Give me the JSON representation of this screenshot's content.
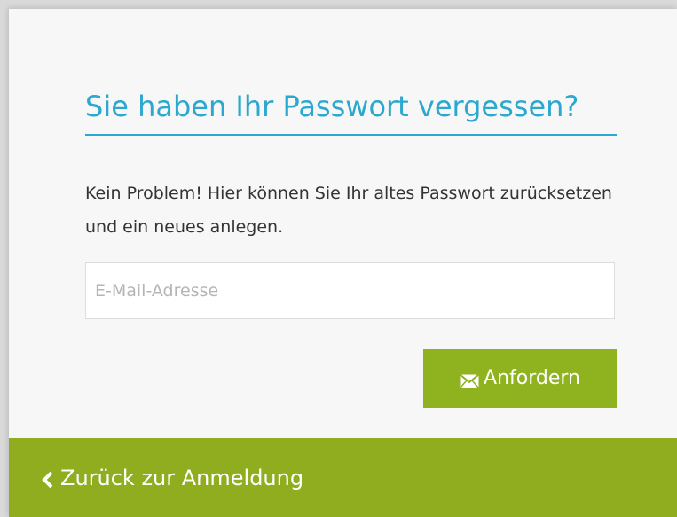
{
  "form": {
    "title": "Sie haben Ihr Passwort vergessen?",
    "description": "Kein Problem! Hier können Sie Ihr altes Passwort zurücksetzen und ein neues anlegen.",
    "email_value": "",
    "email_placeholder": "E-Mail-Adresse",
    "submit_label": "Anfordern",
    "submit_icon": "envelope-icon"
  },
  "footer": {
    "back_label": "Zurück zur Anmeldung",
    "back_icon": "chevron-left-icon"
  },
  "colors": {
    "accent": "#2aa8cf",
    "button": "#8fb31e",
    "footer": "#8fad1e"
  }
}
